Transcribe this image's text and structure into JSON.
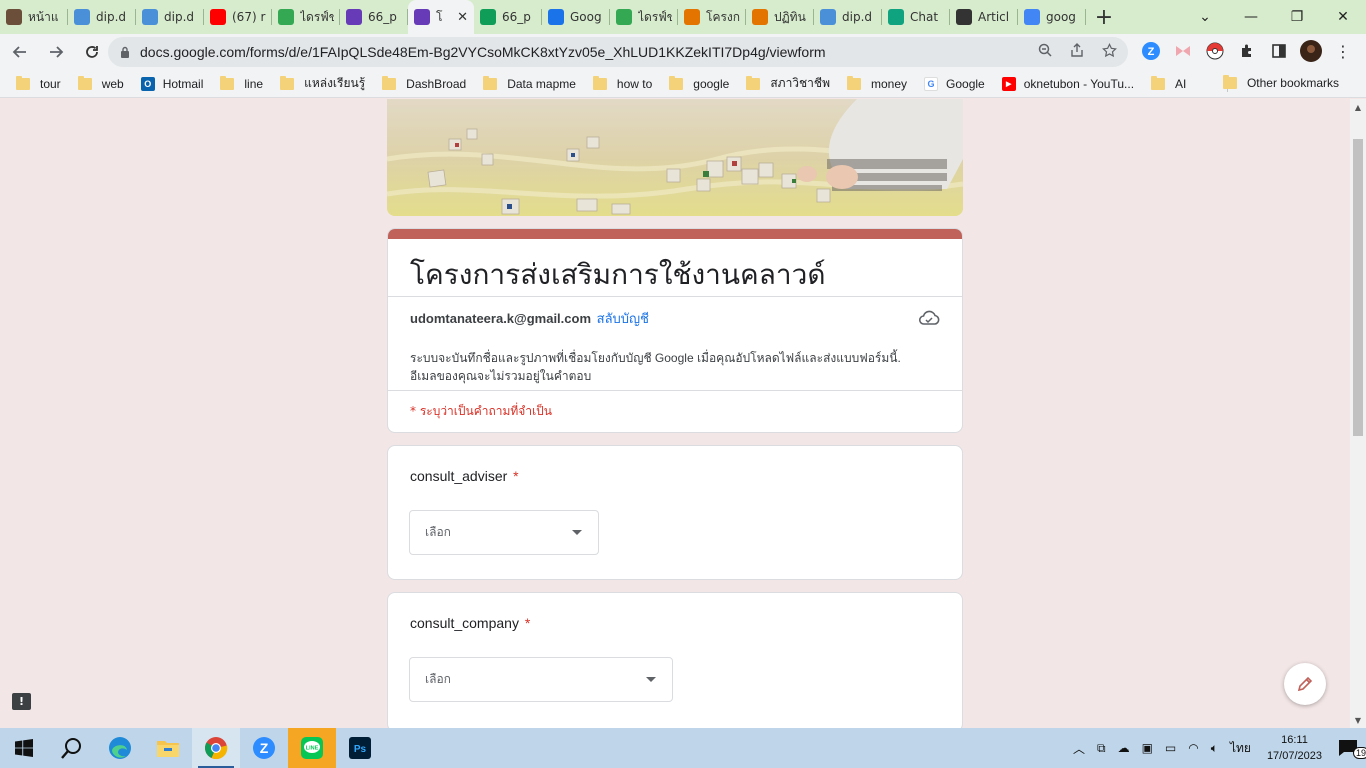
{
  "browser": {
    "tabs": [
      {
        "title": "หน้าแ",
        "icon": "photo-favicon",
        "color": "#6b4f3a"
      },
      {
        "title": "dip.d",
        "icon": "dip-favicon",
        "color": "#4a90d9"
      },
      {
        "title": "dip.d",
        "icon": "dip-favicon",
        "color": "#4a90d9"
      },
      {
        "title": "(67) r",
        "icon": "youtube-icon",
        "color": "#ff0000"
      },
      {
        "title": "ไดรฟ์ข",
        "icon": "drive-icon",
        "color": "#34a853"
      },
      {
        "title": "66_p",
        "icon": "forms-icon",
        "color": "#673ab7"
      },
      {
        "title": "โ",
        "icon": "forms-icon",
        "color": "#673ab7"
      },
      {
        "title": "66_p",
        "icon": "sheets-icon",
        "color": "#0f9d58"
      },
      {
        "title": "Goog",
        "icon": "calendar-icon",
        "color": "#1a73e8"
      },
      {
        "title": "ไดรฟ์ข",
        "icon": "drive-icon",
        "color": "#34a853"
      },
      {
        "title": "โครงก",
        "icon": "looker-icon",
        "color": "#e37400"
      },
      {
        "title": "ปฏิทิน",
        "icon": "looker-icon",
        "color": "#e37400"
      },
      {
        "title": "dip.d",
        "icon": "dip-favicon",
        "color": "#4a90d9"
      },
      {
        "title": "Chat",
        "icon": "chatgpt-icon",
        "color": "#10a37f"
      },
      {
        "title": "Articl",
        "icon": "joomla-icon",
        "color": "#333333"
      },
      {
        "title": "goog",
        "icon": "google-icon",
        "color": "#4285f4"
      }
    ],
    "active_tab_index": 6,
    "url": "docs.google.com/forms/d/e/1FAIpQLSde48Em-Bg2VYCsoMkCK8xtYzv05e_XhLUD1KKZekITI7Dp4g/viewform"
  },
  "bookmarks": [
    {
      "label": "tour",
      "type": "folder"
    },
    {
      "label": "web",
      "type": "folder"
    },
    {
      "label": "Hotmail",
      "type": "outlook"
    },
    {
      "label": "line",
      "type": "folder"
    },
    {
      "label": "แหล่งเรียนรู้",
      "type": "folder"
    },
    {
      "label": "DashBroad",
      "type": "folder"
    },
    {
      "label": "Data mapme",
      "type": "folder"
    },
    {
      "label": "how to",
      "type": "folder"
    },
    {
      "label": "google",
      "type": "folder"
    },
    {
      "label": "สภาวิชาชีพ",
      "type": "folder"
    },
    {
      "label": "money",
      "type": "folder"
    },
    {
      "label": "Google",
      "type": "google"
    },
    {
      "label": "oknetubon - YouTu...",
      "type": "youtube"
    },
    {
      "label": "AI",
      "type": "folder"
    }
  ],
  "bookmarks_other": "Other bookmarks",
  "form": {
    "title": "โครงการส่งเสริมการใช้งานคลาวด์",
    "accent_color": "#c0625a",
    "account_email": "udomtanateera.k@gmail.com",
    "switch_account": "สลับบัญชี",
    "notice": "ระบบจะบันทึกชื่อและรูปภาพที่เชื่อมโยงกับบัญชี Google เมื่อคุณอัปโหลดไฟล์และส่งแบบฟอร์มนี้. อีเมลของคุณจะไม่รวมอยู่ในคำตอบ",
    "required_note": "* ระบุว่าเป็นคำถามที่จำเป็น",
    "questions": [
      {
        "label": "consult_adviser",
        "required_mark": "*",
        "placeholder": "เลือก"
      },
      {
        "label": "consult_company",
        "required_mark": "*",
        "placeholder": "เลือก"
      }
    ]
  },
  "taskbar": {
    "apps": [
      "windows-start-icon",
      "search-icon",
      "edge-icon",
      "file-explorer-icon",
      "chrome-icon",
      "zoom-icon",
      "line-icon",
      "photoshop-icon"
    ],
    "language": "ไทย",
    "time": "16:11",
    "date": "17/07/2023",
    "notification_count": "19"
  }
}
